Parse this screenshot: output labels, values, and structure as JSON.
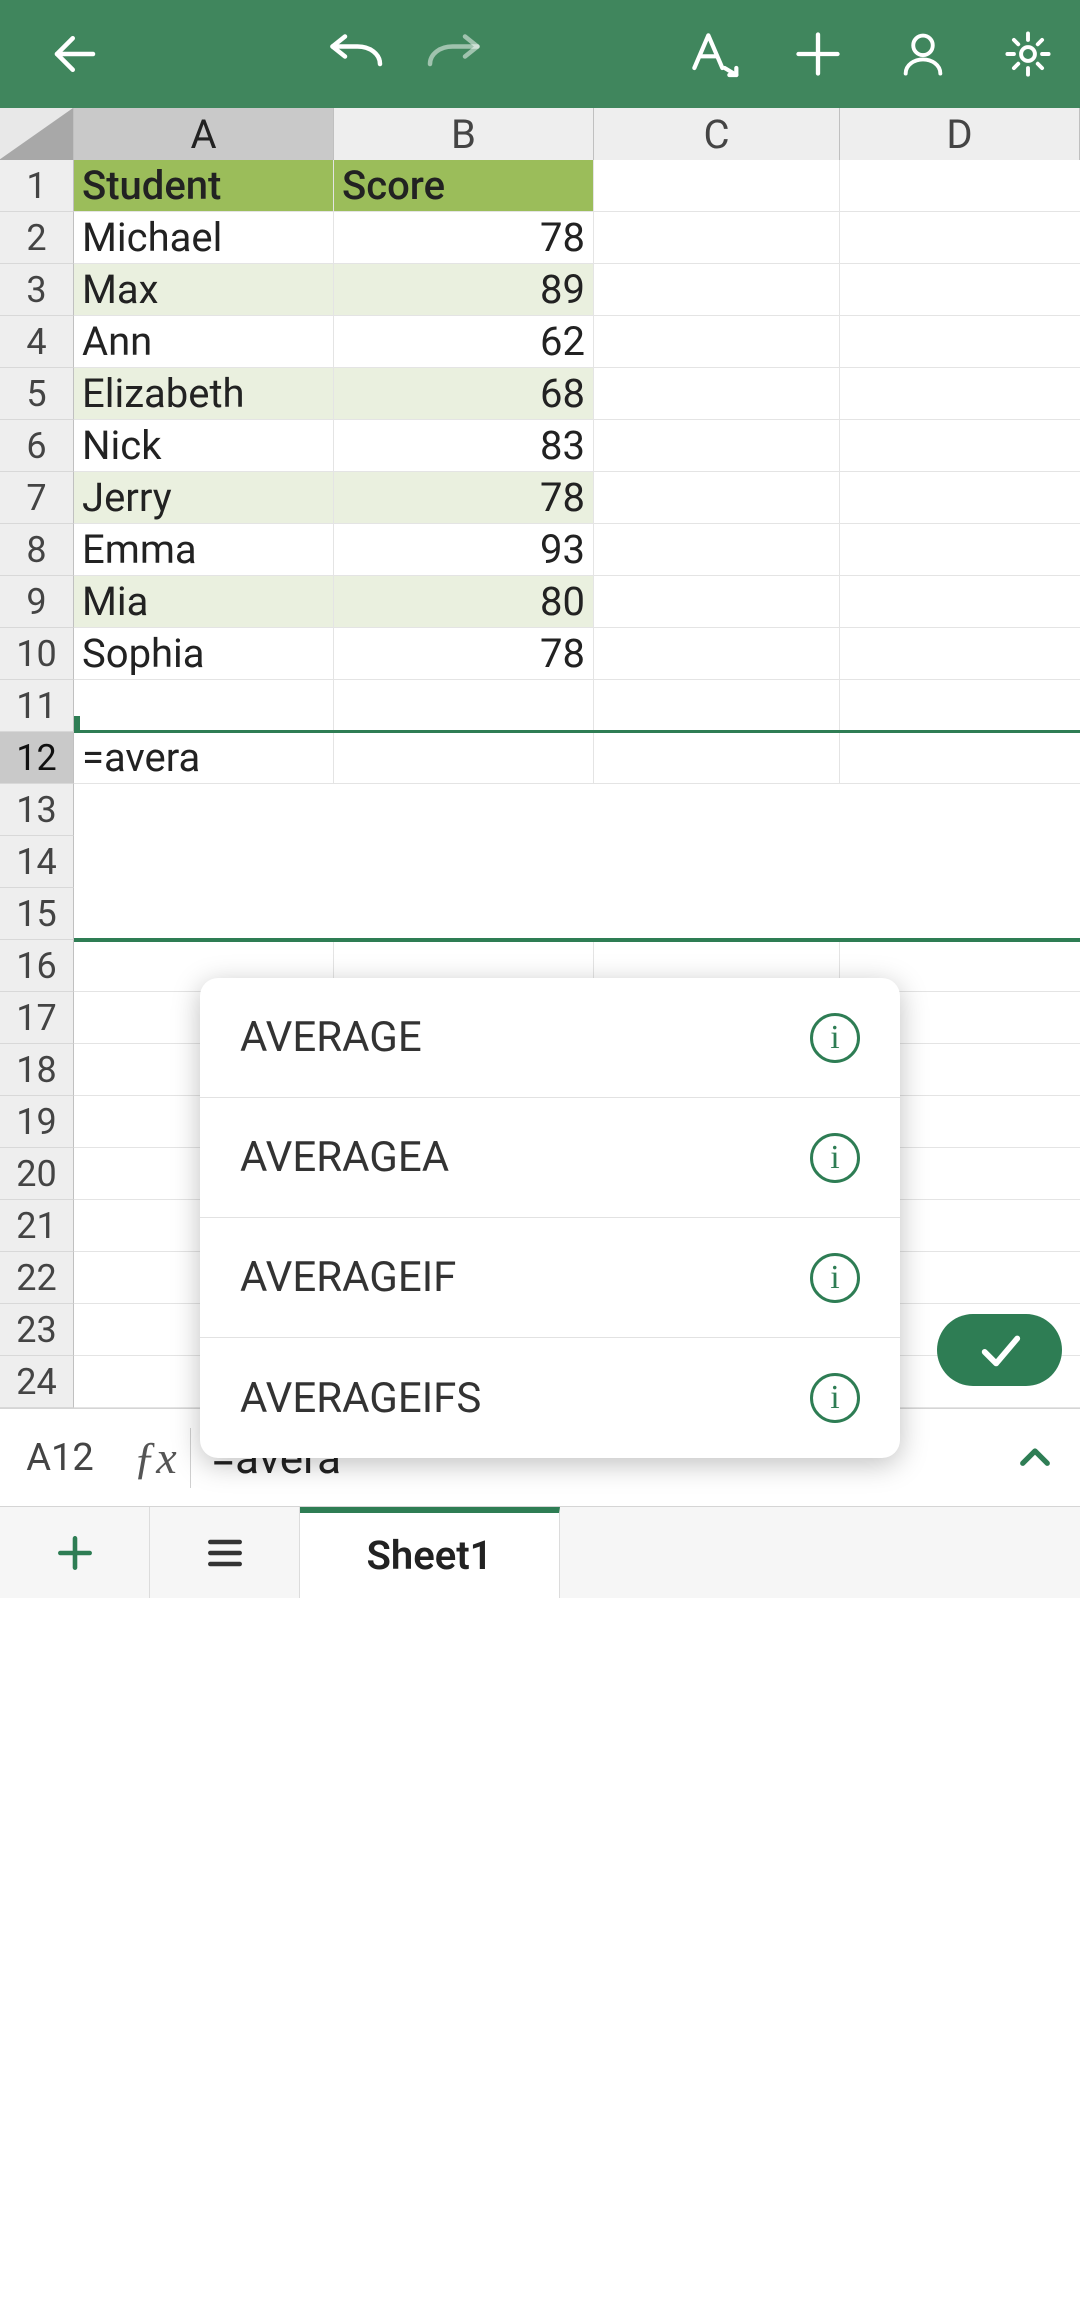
{
  "columns": [
    "A",
    "B",
    "C",
    "D"
  ],
  "selected_column_index": 0,
  "row_count": 24,
  "selected_row_index": 12,
  "table": {
    "headers": {
      "A": "Student",
      "B": "Score"
    },
    "rows": [
      {
        "A": "Michael",
        "B": "78"
      },
      {
        "A": "Max",
        "B": "89"
      },
      {
        "A": "Ann",
        "B": "62"
      },
      {
        "A": "Elizabeth",
        "B": "68"
      },
      {
        "A": "Nick",
        "B": "83"
      },
      {
        "A": "Jerry",
        "B": "78"
      },
      {
        "A": "Emma",
        "B": "93"
      },
      {
        "A": "Mia",
        "B": "80"
      },
      {
        "A": "Sophia",
        "B": "78"
      }
    ]
  },
  "editing_cell": {
    "ref": "A12",
    "display_in_grid": "=avera"
  },
  "formula_bar": {
    "cell_ref": "A12",
    "fx_label": "ƒx",
    "value": "=avera"
  },
  "autocomplete": {
    "items": [
      {
        "label": "AVERAGE"
      },
      {
        "label": "AVERAGEA"
      },
      {
        "label": "AVERAGEIF"
      },
      {
        "label": "AVERAGEIFS"
      }
    ],
    "info_glyph": "i"
  },
  "sheet_tabs": {
    "active": "Sheet1"
  },
  "colors": {
    "brand": "#40865d",
    "accent": "#2e7d54",
    "header_fill": "#9bbd5a",
    "band_fill": "#eaf0df"
  }
}
